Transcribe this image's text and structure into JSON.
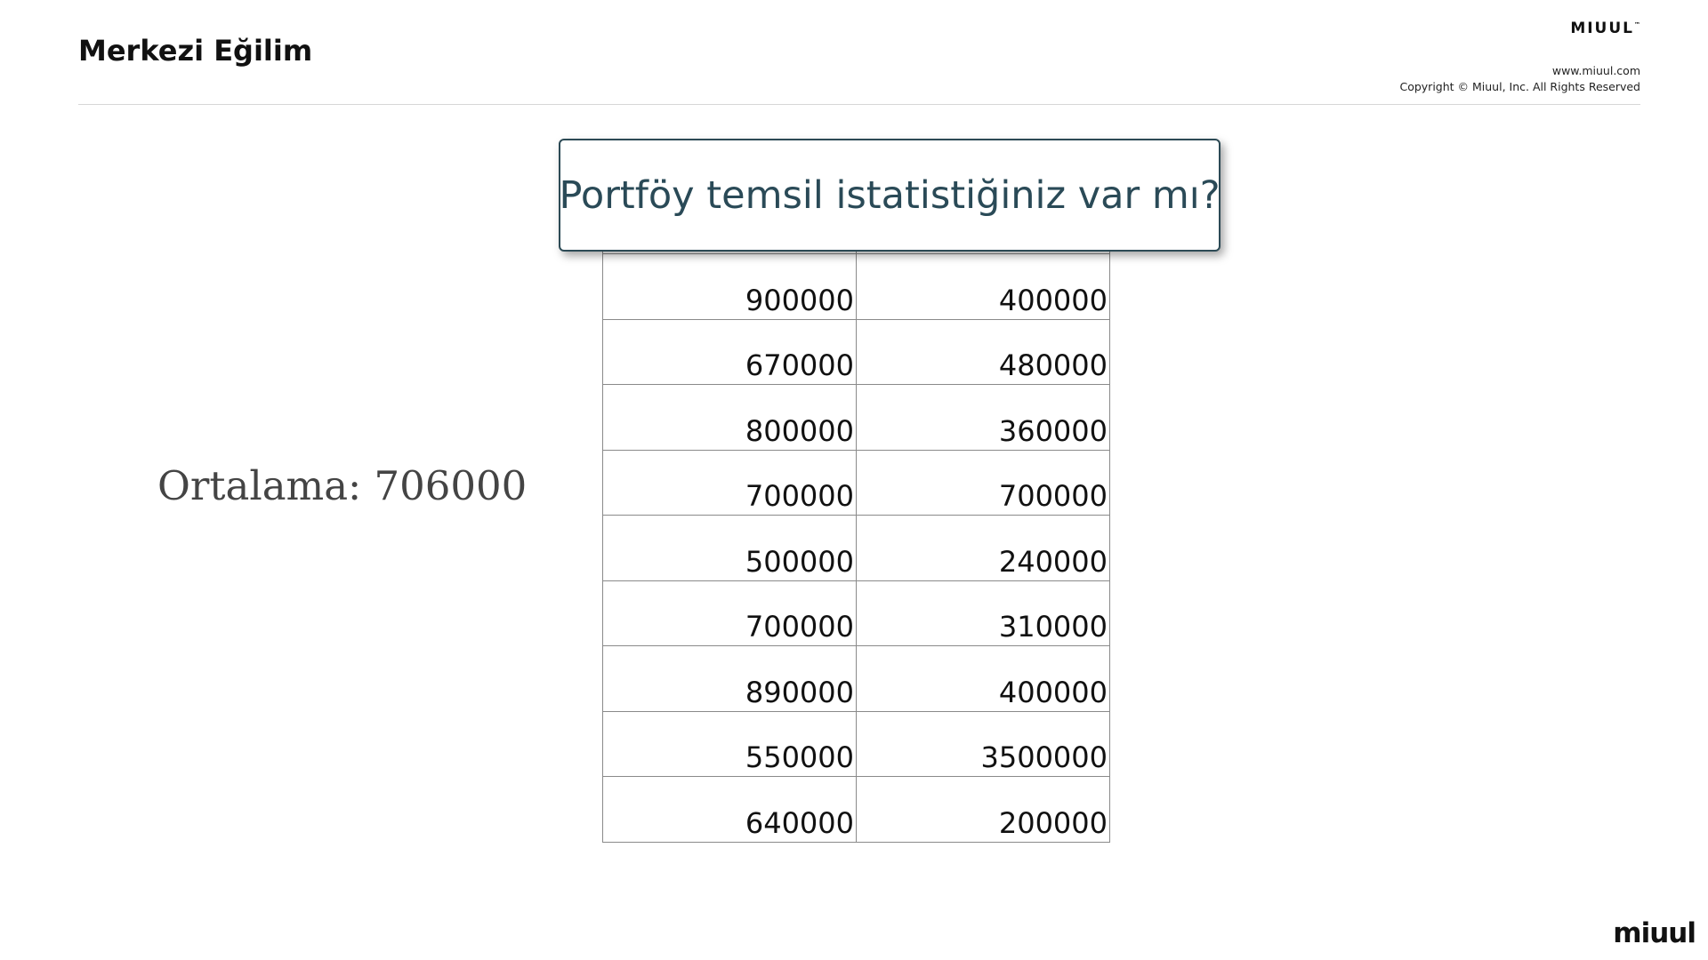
{
  "header": {
    "title": "Merkezi Eğilim",
    "brand": "MIUUL",
    "trademark": "™",
    "url": "www.miuul.com",
    "copyright": "Copyright © Miuul, Inc. All Rights Reserved"
  },
  "mean_label": "Ortalama: 706000",
  "question": "Portföy temsil istatistiğiniz var mı?",
  "table": {
    "rows": [
      [
        "900000",
        "400000"
      ],
      [
        "670000",
        "480000"
      ],
      [
        "800000",
        "360000"
      ],
      [
        "700000",
        "700000"
      ],
      [
        "500000",
        "240000"
      ],
      [
        "700000",
        "310000"
      ],
      [
        "890000",
        "400000"
      ],
      [
        "550000",
        "3500000"
      ],
      [
        "640000",
        "200000"
      ]
    ]
  },
  "footer": {
    "brand": "miuul"
  }
}
